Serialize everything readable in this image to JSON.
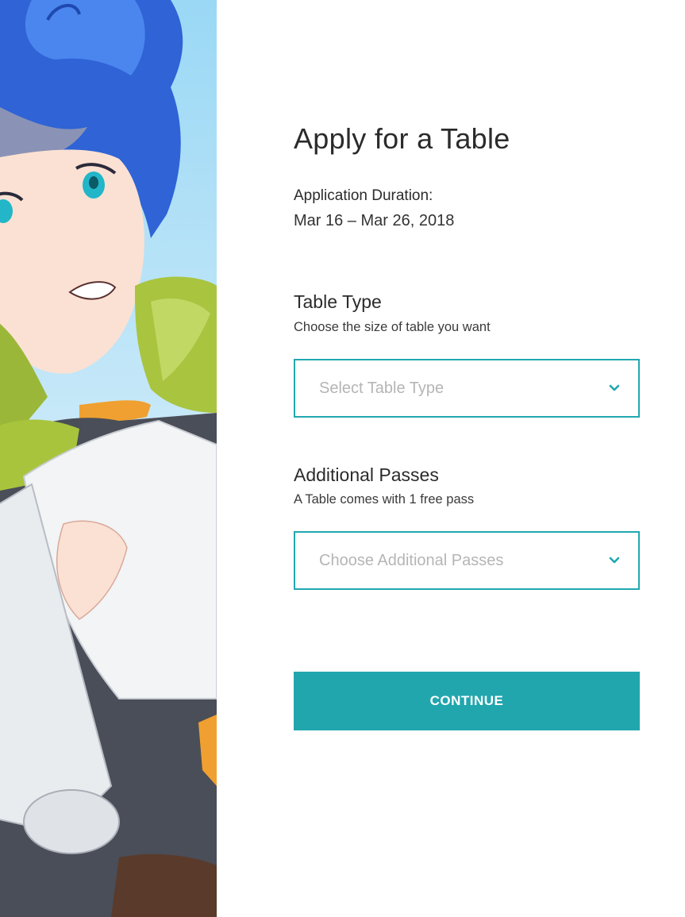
{
  "form": {
    "title": "Apply for a Table",
    "duration_label": "Application Duration:",
    "duration_value": "Mar 16 – Mar 26, 2018",
    "table_type": {
      "heading": "Table Type",
      "subtitle": "Choose the size of table you want",
      "placeholder": "Select Table Type"
    },
    "additional_passes": {
      "heading": "Additional Passes",
      "subtitle": "A Table comes with 1 free pass",
      "placeholder": "Choose Additional Passes"
    },
    "continue_label": "CONTINUE"
  },
  "colors": {
    "accent": "#21a6ae",
    "placeholder": "#b5b5b5",
    "text": "#2b2b2b"
  },
  "icons": {
    "dropdown": "chevron-down-icon"
  },
  "illustration": {
    "subject": "anime-character-artwork"
  }
}
